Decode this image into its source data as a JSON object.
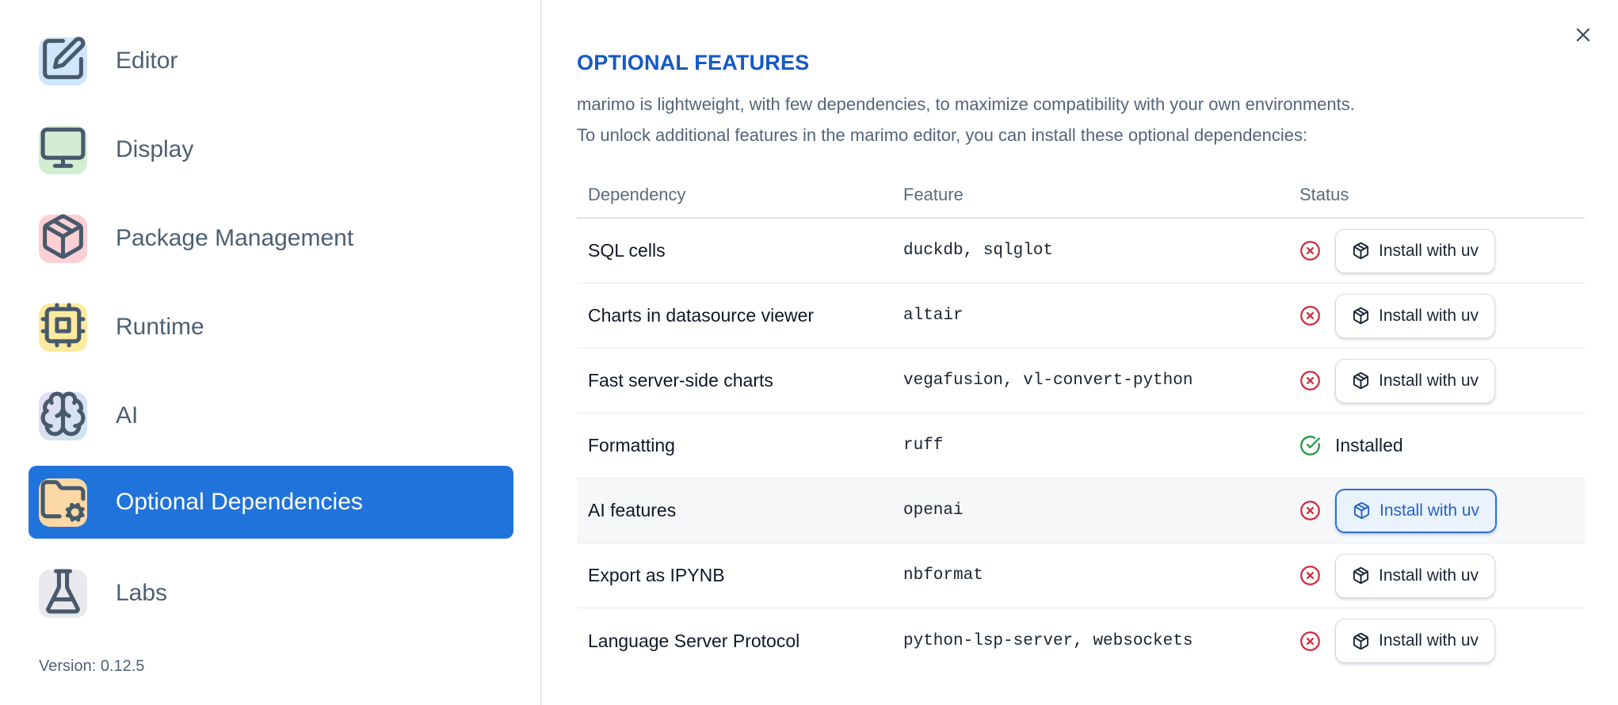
{
  "sidebar": {
    "items": [
      {
        "label": "Editor",
        "icon": "square-pen-icon",
        "icon_bg": "#cfe6fc",
        "selected": false
      },
      {
        "label": "Display",
        "icon": "monitor-icon",
        "icon_bg": "#d2eed2",
        "selected": false
      },
      {
        "label": "Package Management",
        "icon": "package-icon",
        "icon_bg": "#fcd0d4",
        "selected": false
      },
      {
        "label": "Runtime",
        "icon": "cpu-icon",
        "icon_bg": "#fcea9e",
        "selected": false
      },
      {
        "label": "AI",
        "icon": "brain-icon",
        "icon_bg": "linear-gradient(135deg,#e8d9f6 0%,#c9e9f0 100%)",
        "selected": false
      },
      {
        "label": "Optional Dependencies",
        "icon": "folder-cog-icon",
        "icon_bg": "#fcd9a4",
        "selected": true
      },
      {
        "label": "Labs",
        "icon": "flask-icon",
        "icon_bg": "#e9e9ec",
        "selected": false
      }
    ],
    "version_label": "Version: 0.12.5"
  },
  "panel": {
    "title": "OPTIONAL FEATURES",
    "description_line1": "marimo is lightweight, with few dependencies, to maximize compatibility with your own environments.",
    "description_line2": "To unlock additional features in the marimo editor, you can install these optional dependencies:",
    "close_icon": "x-icon"
  },
  "table": {
    "headers": [
      "Dependency",
      "Feature",
      "Status"
    ],
    "rows": [
      {
        "dependency": "SQL cells",
        "feature": "duckdb, sqlglot",
        "status": "not-installed",
        "status_icon": "circle-x-icon",
        "action": "Install with uv",
        "highlighted": false
      },
      {
        "dependency": "Charts in datasource viewer",
        "feature": "altair",
        "status": "not-installed",
        "status_icon": "circle-x-icon",
        "action": "Install with uv",
        "highlighted": false
      },
      {
        "dependency": "Fast server-side charts",
        "feature": "vegafusion, vl-convert-python",
        "status": "not-installed",
        "status_icon": "circle-x-icon",
        "action": "Install with uv",
        "highlighted": false
      },
      {
        "dependency": "Formatting",
        "feature": "ruff",
        "status": "installed",
        "status_icon": "circle-check-icon",
        "status_label": "Installed",
        "highlighted": false
      },
      {
        "dependency": "AI features",
        "feature": "openai",
        "status": "not-installed",
        "status_icon": "circle-x-icon",
        "action": "Install with uv",
        "highlighted": true
      },
      {
        "dependency": "Export as IPYNB",
        "feature": "nbformat",
        "status": "not-installed",
        "status_icon": "circle-x-icon",
        "action": "Install with uv",
        "highlighted": false
      },
      {
        "dependency": "Language Server Protocol",
        "feature": "python-lsp-server, websockets",
        "status": "not-installed",
        "status_icon": "circle-x-icon",
        "action": "Install with uv",
        "highlighted": false
      }
    ]
  },
  "colors": {
    "selection_blue": "#2173dc",
    "title_blue": "#1559c7",
    "accent_button_blue": "#2063c9",
    "error_red": "#d42a3c",
    "success_green": "#1f9a41"
  }
}
